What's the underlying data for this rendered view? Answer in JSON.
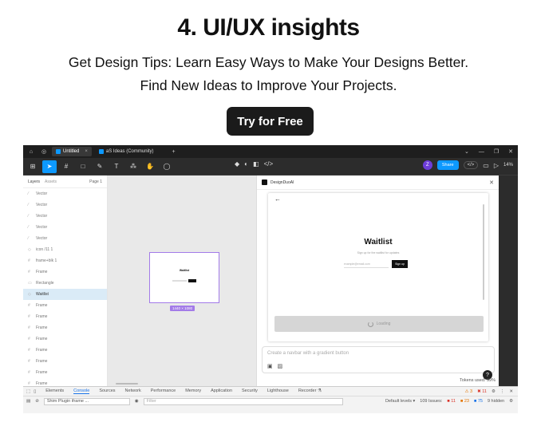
{
  "hero": {
    "title": "4. UI/UX insights",
    "subtitle_line1": "Get Design Tips: Learn Easy Ways to Make Your Designs Better.",
    "subtitle_line2": "Find New Ideas to Improve Your Projects.",
    "cta_label": "Try for Free"
  },
  "app": {
    "tabs": [
      {
        "label": "Untitled",
        "active": true
      },
      {
        "label": "aS Ideas (Community)",
        "active": false
      }
    ],
    "toolbar": {
      "avatar_initial": "Z",
      "share_label": "Share",
      "zoom": "14%"
    },
    "layers_panel": {
      "tab_layers": "Layers",
      "tab_assets": "Assets",
      "page": "Page 1",
      "items": [
        {
          "icon": "vector-icon",
          "label": "Vector"
        },
        {
          "icon": "vector-icon",
          "label": "Vector"
        },
        {
          "icon": "vector-icon",
          "label": "Vector"
        },
        {
          "icon": "vector-icon",
          "label": "Vector"
        },
        {
          "icon": "vector-icon",
          "label": "Vector"
        },
        {
          "icon": "component-icon",
          "label": "icon /11 1"
        },
        {
          "icon": "frame-icon",
          "label": "frame+blk 1"
        },
        {
          "icon": "frame-icon",
          "label": "Frame"
        },
        {
          "icon": "rectangle-icon",
          "label": "Rectangle"
        },
        {
          "icon": "component-icon",
          "label": "Waitlist",
          "selected": true
        },
        {
          "icon": "frame-icon",
          "label": "Frame"
        },
        {
          "icon": "frame-icon",
          "label": "Frame"
        },
        {
          "icon": "frame-icon",
          "label": "Frame"
        },
        {
          "icon": "frame-icon",
          "label": "Frame"
        },
        {
          "icon": "frame-icon",
          "label": "Frame"
        },
        {
          "icon": "frame-icon",
          "label": "Frame"
        },
        {
          "icon": "frame-icon",
          "label": "Frame"
        },
        {
          "icon": "frame-icon",
          "label": "Frame"
        },
        {
          "icon": "frame-icon",
          "label": "Frame"
        }
      ]
    },
    "canvas": {
      "artboard_title": "Waitlist",
      "size_badge": "1440 × 1080"
    },
    "plugin": {
      "title": "DesignDuoAI",
      "preview_title": "Waitlist",
      "preview_sub": "Sign up for the waitlist for updates",
      "email_placeholder": "example@email.com",
      "signup_label": "Sign up",
      "loading_label": "Loading",
      "prompt_placeholder": "Create a navbar with a gradient button",
      "tokens": "Tokens used: 99%",
      "help": "?"
    },
    "devtools": {
      "tabs": [
        "Elements",
        "Console",
        "Sources",
        "Network",
        "Performance",
        "Memory",
        "Application",
        "Security",
        "Lighthouse",
        "Recorder ⚗"
      ],
      "active_tab": "Console",
      "context": "Shim Plugin iframe ...",
      "filter_placeholder": "Filter",
      "levels": "Default levels ▾",
      "issues_label": "109 Issues:",
      "err_count": "11",
      "warn_count": "23",
      "info_count": "75",
      "hidden": "9 hidden",
      "top_warn": "3",
      "top_err": "11"
    }
  }
}
